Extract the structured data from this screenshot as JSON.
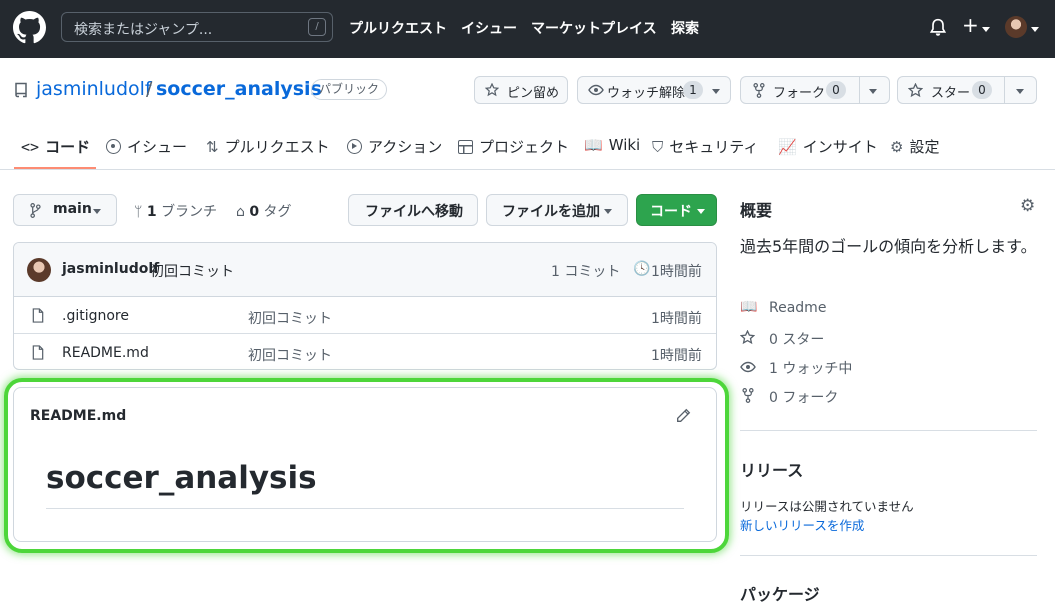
{
  "header": {
    "search_placeholder": "検索またはジャンプ...",
    "search_key": "/",
    "nav": [
      "プルリクエスト",
      "イシュー",
      "マーケットプレイス",
      "探索"
    ]
  },
  "repo": {
    "owner": "jasminludolf",
    "separator": "/",
    "name": "soccer_analysis",
    "visibility": "パブリック",
    "pin_label": "ピン留め",
    "watch_label": "ウォッチ解除",
    "watch_count": "1",
    "fork_label": "フォーク",
    "fork_count": "0",
    "star_label": "スター",
    "star_count": "0"
  },
  "tabs": [
    {
      "label": "コード"
    },
    {
      "label": "イシュー"
    },
    {
      "label": "プルリクエスト"
    },
    {
      "label": "アクション"
    },
    {
      "label": "プロジェクト"
    },
    {
      "label": "Wiki"
    },
    {
      "label": "セキュリティ"
    },
    {
      "label": "インサイト"
    },
    {
      "label": "設定"
    }
  ],
  "branchbar": {
    "branch": "main",
    "branch_count": "1",
    "branch_label": "ブランチ",
    "tag_count": "0",
    "tag_label": "タグ",
    "goto_file": "ファイルへ移動",
    "add_file": "ファイルを追加",
    "code_button": "コード"
  },
  "commit": {
    "author": "jasminludolf",
    "message": "初回コミット",
    "count": "1 コミット",
    "time": "1時間前"
  },
  "files": [
    {
      "name": ".gitignore",
      "message": "初回コミット",
      "time": "1時間前"
    },
    {
      "name": "README.md",
      "message": "初回コミット",
      "time": "1時間前"
    }
  ],
  "readme": {
    "file_label": "README.md",
    "heading": "soccer_analysis"
  },
  "sidebar": {
    "about_title": "概要",
    "description": "過去5年間のゴールの傾向を分析します。",
    "readme": "Readme",
    "stars": "0 スター",
    "watching": "1 ウォッチ中",
    "forks": "0 フォーク",
    "releases_title": "リリース",
    "no_releases": "リリースは公開されていません",
    "create_release": "新しいリリースを作成",
    "packages_title": "パッケージ"
  },
  "colors": {
    "header_bg": "#24292f",
    "link": "#0969da",
    "primary_green": "#2da44e",
    "highlight_outline": "#4dd63a",
    "tab_underline": "#fd8c73"
  }
}
